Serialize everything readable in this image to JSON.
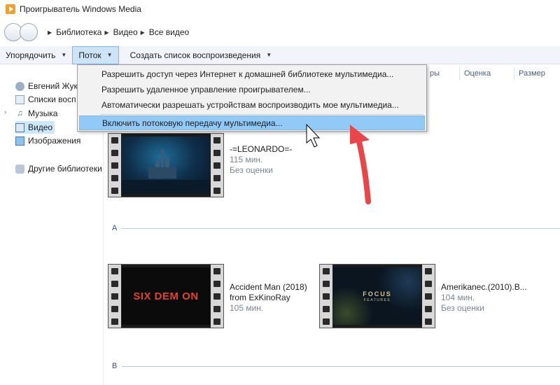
{
  "window": {
    "title": "Проигрыватель Windows Media"
  },
  "breadcrumb": [
    "Библиотека",
    "Видео",
    "Все видео"
  ],
  "toolbar": {
    "organize_label": "Упорядочить",
    "stream_label": "Поток",
    "create_playlist_label": "Создать список воспроизведения"
  },
  "columns": {
    "partial_header": "ры",
    "rating": "Оценка",
    "size": "Размер"
  },
  "nav": {
    "user": "Евгений Жук",
    "playlists": "Списки восп",
    "music": "Музыка",
    "video": "Видео",
    "images": "Изображения",
    "other_libraries": "Другие библиотеки"
  },
  "stream_menu": {
    "items": [
      "Разрешить доступ через Интернет к домашней библиотеке мультимедиа...",
      "Разрешить удаленное управление проигрывателем...",
      "Автоматически разрешать устройствам воспроизводить мое мультимедиа...",
      "Включить потоковую передачу мультимедиа..."
    ],
    "highlighted_index": 3
  },
  "groups": {
    "a": "A",
    "b": "B"
  },
  "videos": [
    {
      "title": "-=LEONARDO=-",
      "duration": "115 мин.",
      "rating": "Без оценки"
    },
    {
      "title": "Accident Man (2018)\nfrom ExKinoRay",
      "duration": "105 мин.",
      "rating": ""
    },
    {
      "title": "Amerikanec.(2010).B...",
      "duration": "104 мин.",
      "rating": "Без оценки"
    }
  ],
  "thumbnails": {
    "sixdemon_text": "SIX DEM ON",
    "focus_text": "FOCUS",
    "focus_sub": "FEATURES"
  },
  "colors": {
    "menu_highlight": "#91c9f7",
    "toolbar_active": "#cde4f7",
    "annotation_arrow": "#e8474a"
  }
}
